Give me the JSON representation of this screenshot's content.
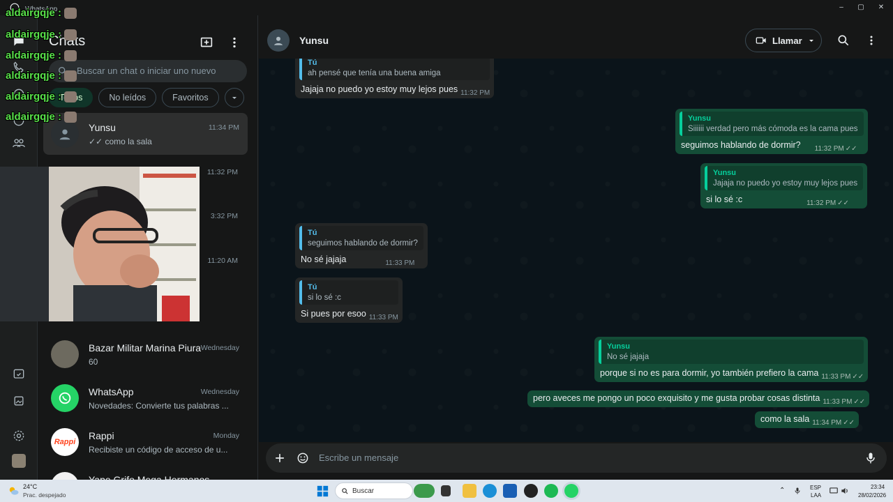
{
  "window": {
    "title": "WhatsApp",
    "minimize": "–",
    "maximize": "▢",
    "close": "✕"
  },
  "sidebar": {
    "title": "Chats",
    "search_placeholder": "Buscar un chat o iniciar uno nuevo",
    "filters": [
      "Todos",
      "No leídos",
      "Favoritos"
    ],
    "chats": [
      {
        "name": "Yunsu",
        "time": "11:34 PM",
        "preview": "✓✓ como la sala"
      },
      {
        "name": "Bazar Militar Marina Piura",
        "time": "Wednesday",
        "preview": "60"
      },
      {
        "name": "WhatsApp",
        "time": "Wednesday",
        "preview": "Novedades: Convierte tus palabras ..."
      },
      {
        "name": "Rappi",
        "time": "Monday",
        "preview": "Recibiste un código de acceso de u..."
      },
      {
        "name": "Yape Grifo Mega Hermanos",
        "time": "",
        "preview": ""
      }
    ],
    "hidden_times": [
      "11:32 PM",
      "3:32 PM",
      "11:20 AM"
    ]
  },
  "chat": {
    "contact": "Yunsu",
    "call_label": "Llamar",
    "composer_placeholder": "Escribe un mensaje",
    "messages": [
      {
        "dir": "in",
        "quote_author": "Tú",
        "quote": "ah pensé que tenía una buena amiga",
        "text": "Jajaja no puedo yo estoy muy lejos pues",
        "time": "11:32 PM"
      },
      {
        "dir": "out",
        "quote_author": "Yunsu",
        "quote": "Siiiiii verdad pero más cómoda es la cama pues",
        "text": "seguimos hablando de dormir?",
        "time": "11:32 PM"
      },
      {
        "dir": "out",
        "quote_author": "Yunsu",
        "quote": "Jajaja no puedo yo estoy muy lejos pues",
        "text": "si lo sé :c",
        "time": "11:32 PM"
      },
      {
        "dir": "in",
        "quote_author": "Tú",
        "quote": "seguimos hablando de dormir?",
        "text": "No sé jajaja",
        "time": "11:33 PM"
      },
      {
        "dir": "in",
        "quote_author": "Tú",
        "quote": "si lo sé :c",
        "text": "Si pues por esoo",
        "time": "11:33 PM"
      },
      {
        "dir": "out",
        "quote_author": "Yunsu",
        "quote": "No sé jajaja",
        "text": "porque si no es para dormir, yo también prefiero la cama",
        "time": "11:33 PM"
      },
      {
        "dir": "out",
        "quote_author": "",
        "quote": "",
        "text": "pero aveces me pongo un poco exquisito y me gusta probar cosas distinta",
        "time": "11:33 PM"
      },
      {
        "dir": "out",
        "quote_author": "",
        "quote": "",
        "text": "como la sala",
        "time": "11:34 PM"
      }
    ]
  },
  "overlay": {
    "username": "aldairgqje",
    "suffix": " :"
  },
  "taskbar": {
    "weather_temp": "24°C",
    "weather_desc": "Prac. despejado",
    "search": "Buscar",
    "lang": "ESP",
    "region": "LAA",
    "time": "23:34",
    "date": "28/02/2026"
  },
  "colors": {
    "accent": "#00a884",
    "outgoing": "#144d37",
    "incoming": "#242626",
    "overlay_text": "#59e14a"
  }
}
